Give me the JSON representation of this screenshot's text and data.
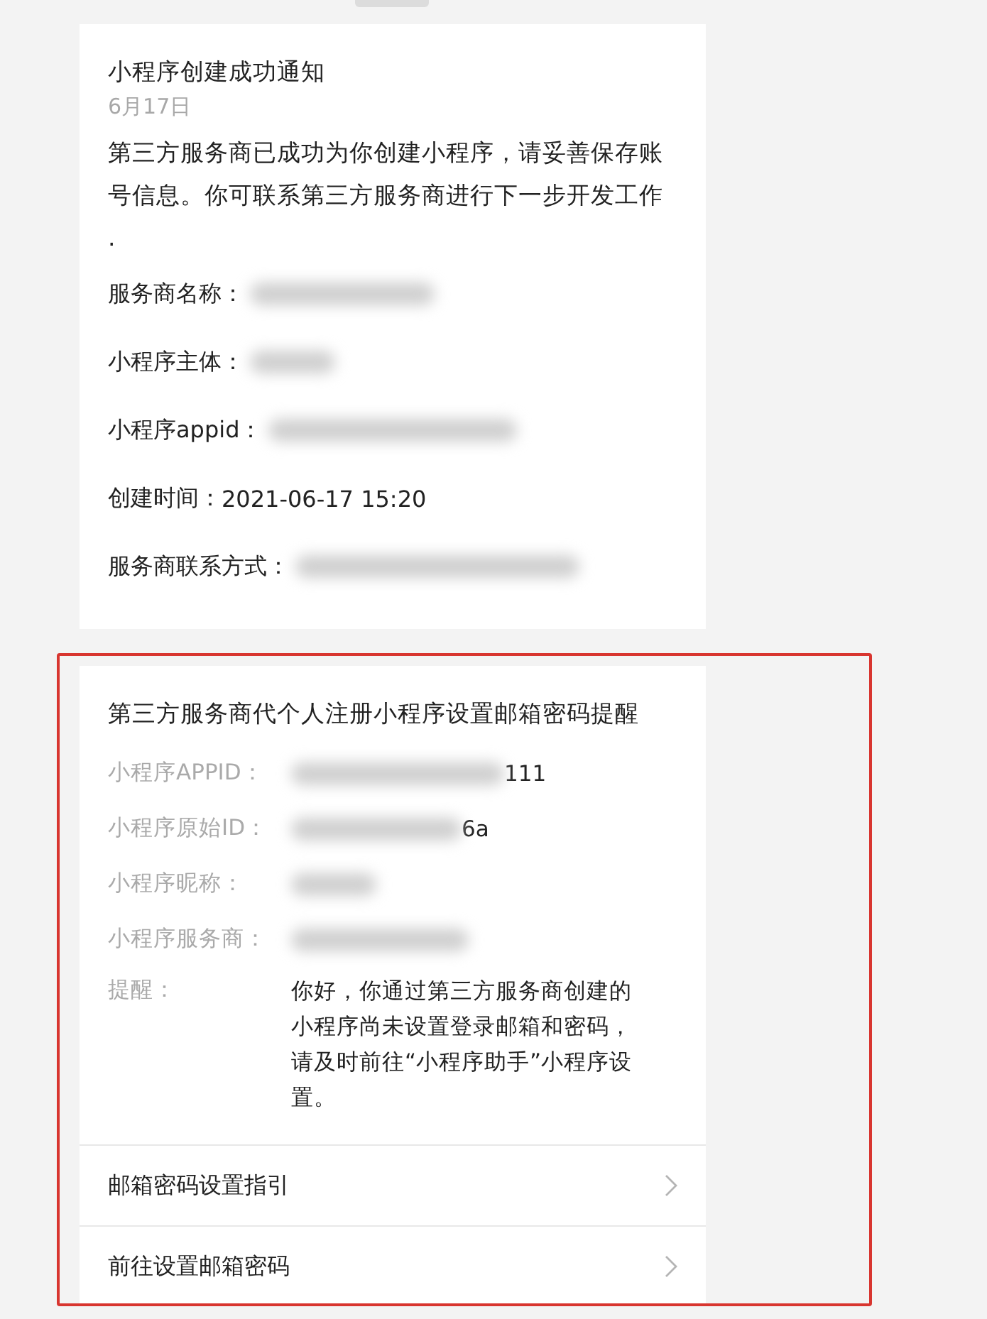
{
  "notification": {
    "title": "小程序创建成功通知",
    "date": "6月17日",
    "message": "第三方服务商已成功为你创建小程序，请妥善保存账号信息。你可联系第三方服务商进行下一步开发工作.",
    "fields": [
      {
        "label": "服务商名称：",
        "redacted": true
      },
      {
        "label": "小程序主体：",
        "redacted": true
      },
      {
        "label": "小程序appid：",
        "redacted": true
      },
      {
        "label": "创建时间：",
        "value": "2021-06-17 15:20",
        "redacted": false
      },
      {
        "label": "服务商联系方式：",
        "redacted": true
      }
    ]
  },
  "reminder": {
    "highlighted": true,
    "title": "第三方服务商代个人注册小程序设置邮箱密码提醒",
    "fields": [
      {
        "label": "小程序APPID：",
        "redacted": true,
        "value": "111"
      },
      {
        "label": "小程序原始ID：",
        "redacted": true,
        "value": "6a"
      },
      {
        "label": "小程序昵称：",
        "redacted": true
      },
      {
        "label": "小程序服务商：",
        "redacted": true
      },
      {
        "label": "提醒：",
        "value": "你好，你通过第三方服务商创建的小程序尚未设置登录邮箱和密码，请及时前往“小程序助手”小程序设置。",
        "redacted": false
      }
    ],
    "links": [
      {
        "label": "邮箱密码设置指引"
      },
      {
        "label": "前往设置邮箱密码"
      }
    ]
  }
}
